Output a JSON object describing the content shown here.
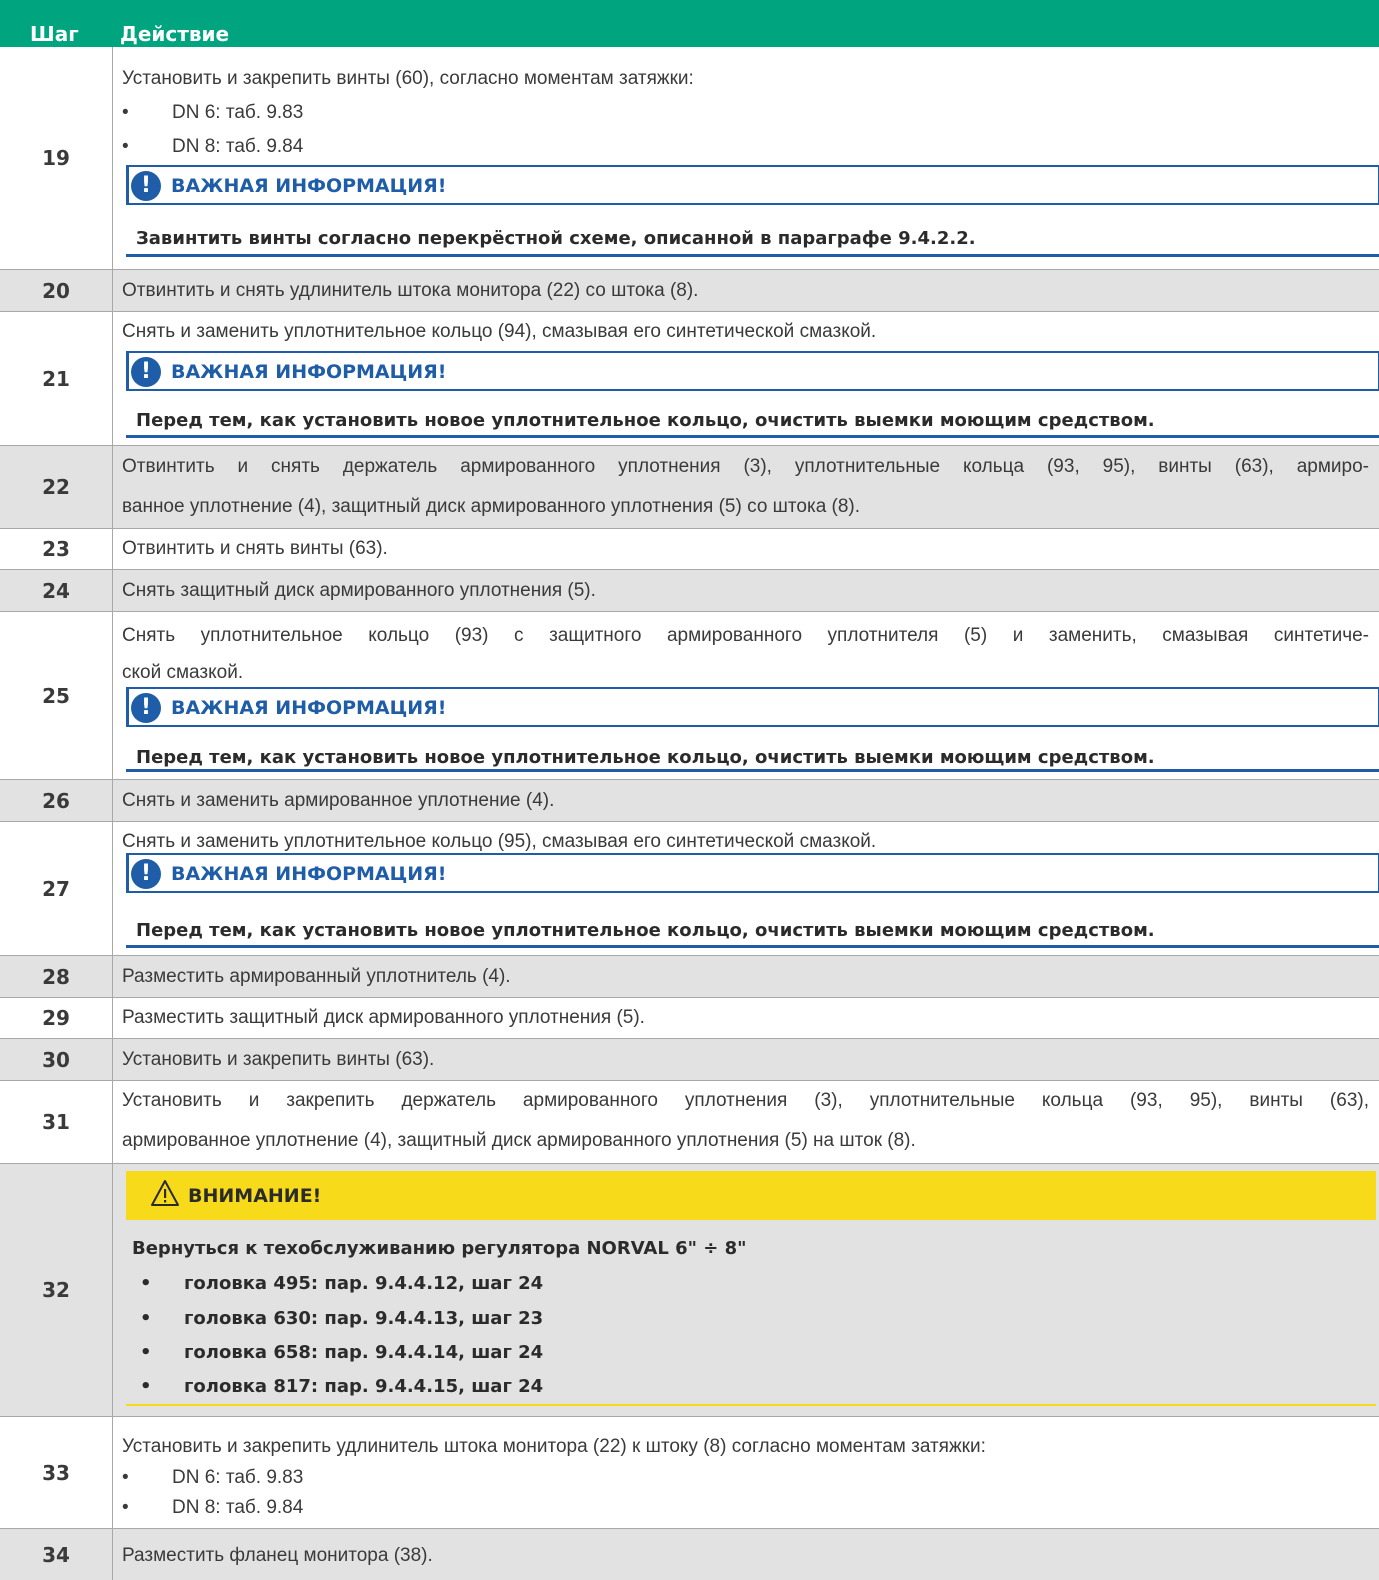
{
  "header": {
    "step_label": "Шаг",
    "action_label": "Действие"
  },
  "notice": {
    "title": "ВАЖНАЯ ИНФОРМАЦИЯ!"
  },
  "rows": {
    "r19": {
      "num": "19",
      "text": "Установить и закрепить винты (60), согласно моментам затяжки:",
      "b1": "DN 6: таб. 9.83",
      "b2": "DN 8: таб. 9.84",
      "note": "Завинтить винты согласно перекрёстной схеме, описанной в параграфе 9.4.2.2."
    },
    "r20": {
      "num": "20",
      "text": "Отвинтить и снять удлинитель штока монитора (22) со штока (8)."
    },
    "r21": {
      "num": "21",
      "text": "Снять и заменить уплотнительное кольцо (94), смазывая его синтетической смазкой.",
      "note": "Перед тем, как установить новое уплотнительное кольцо, очистить выемки моющим средством."
    },
    "r22": {
      "num": "22",
      "line1": "Отвинтить и снять держатель армированного уплотнения (3), уплотнительные кольца (93, 95), винты (63), армиро-",
      "line2": "ванное уплотнение (4), защитный диск армированного уплотнения (5) со штока (8)."
    },
    "r23": {
      "num": "23",
      "text": "Отвинтить и снять винты (63)."
    },
    "r24": {
      "num": "24",
      "text": "Снять защитный диск армированного уплотнения (5)."
    },
    "r25": {
      "num": "25",
      "line1": "Снять уплотнительное кольцо (93) с защитного армированного уплотнителя (5) и заменить, смазывая синтетиче-",
      "line2": "ской смазкой.",
      "note": "Перед тем, как установить новое уплотнительное кольцо, очистить выемки моющим средством."
    },
    "r26": {
      "num": "26",
      "text": "Снять и заменить армированное уплотнение (4)."
    },
    "r27": {
      "num": "27",
      "text": "Снять и заменить уплотнительное кольцо (95), смазывая его синтетической смазкой.",
      "note": "Перед тем, как установить новое уплотнительное кольцо, очистить выемки моющим средством."
    },
    "r28": {
      "num": "28",
      "text": "Разместить армированный уплотнитель (4)."
    },
    "r29": {
      "num": "29",
      "text": "Разместить защитный диск армированного уплотнения (5)."
    },
    "r30": {
      "num": "30",
      "text": "Установить и закрепить винты (63)."
    },
    "r31": {
      "num": "31",
      "line1": "Установить и закрепить держатель армированного уплотнения (3), уплотнительные кольца (93, 95), винты (63),",
      "line2": "армированное уплотнение (4), защитный диск армированного уплотнения (5) на шток (8)."
    },
    "r32": {
      "num": "32",
      "warn_title": "ВНИМАНИЕ!",
      "intro": "Вернуться к техобслуживанию регулятора NORVAL 6\" ÷ 8\"",
      "items": [
        "головка 495: пар. 9.4.4.12, шаг 24",
        "головка 630: пар. 9.4.4.13, шаг 23",
        "головка 658: пар. 9.4.4.14, шаг 24",
        "головка 817: пар. 9.4.4.15, шаг 24"
      ]
    },
    "r33": {
      "num": "33",
      "text": "Установить и закрепить удлинитель штока монитора (22) к штоку (8) согласно моментам затяжки:",
      "b1": "DN 6: таб. 9.83",
      "b2": "DN 8: таб. 9.84"
    },
    "r34": {
      "num": "34",
      "text": "Разместить фланец монитора (38)."
    }
  },
  "bullet": "•",
  "colors": {
    "header": "#00a57f",
    "notice_blue": "#1f5da9",
    "warning_yellow": "#f7db1a",
    "row_shade": "#e2e2e2"
  }
}
